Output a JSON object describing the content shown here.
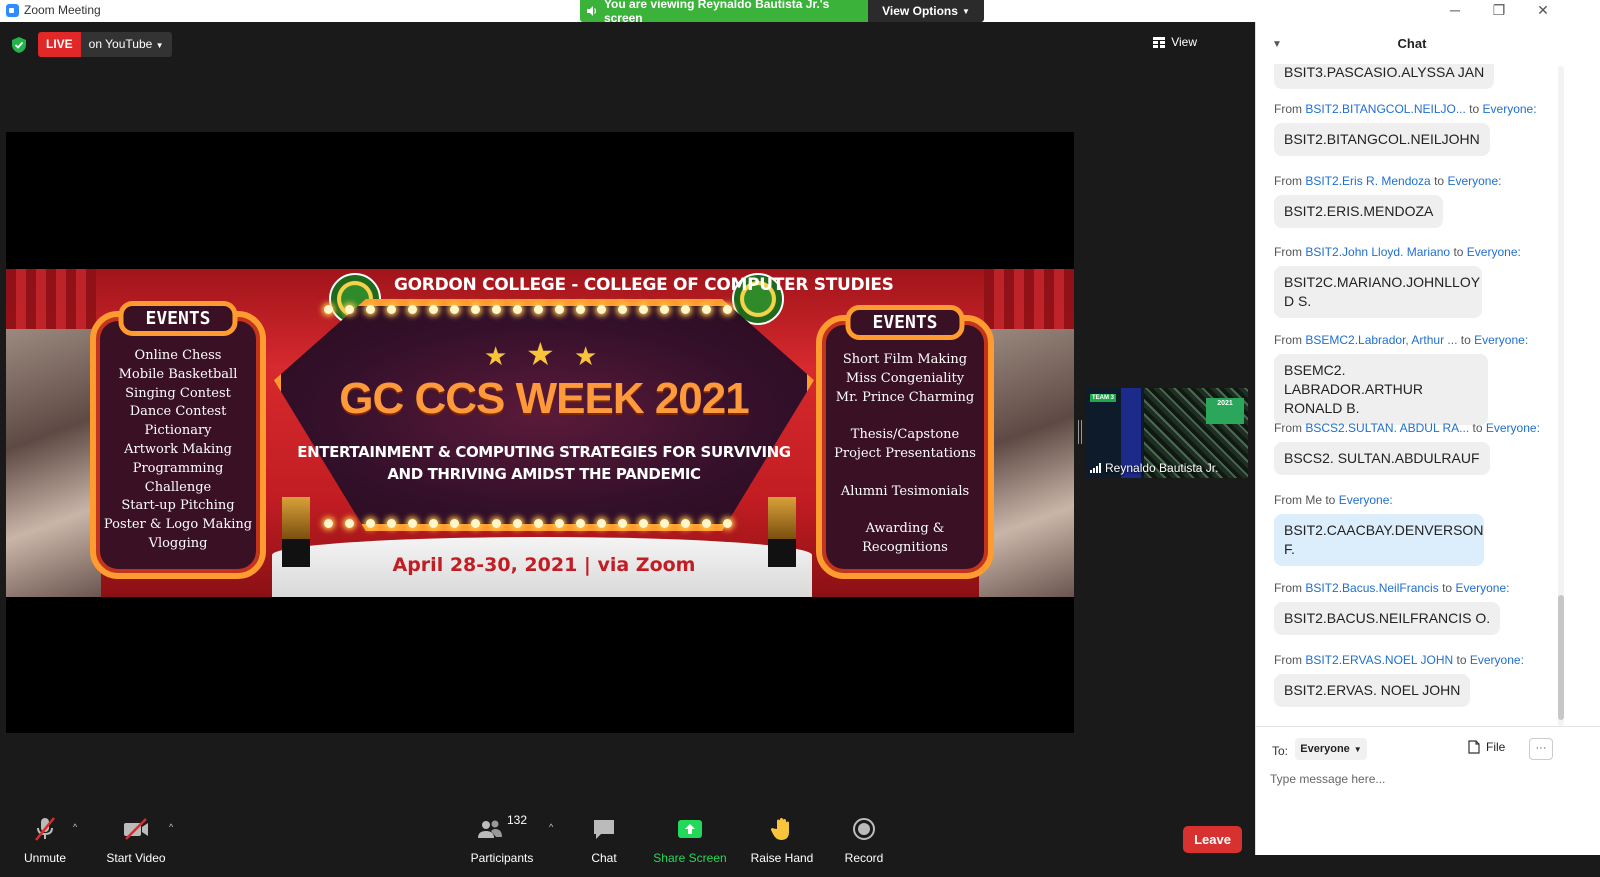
{
  "window": {
    "title": "Zoom Meeting",
    "minimize": "─",
    "restore": "❐",
    "close": "✕"
  },
  "banner": {
    "viewing_text": "You are viewing Reynaldo Bautista Jr.'s screen",
    "view_options": "View Options"
  },
  "live": {
    "label": "LIVE",
    "destination": "on YouTube"
  },
  "view_button": "View",
  "shared_content": {
    "college_title": "GORDON COLLEGE - COLLEGE OF COMPUTER STUDIES",
    "events_left_heading": "EVENTS",
    "events_left": [
      "Online Chess",
      "Mobile Basketball",
      "Singing Contest",
      "Dance Contest",
      "Pictionary",
      "Artwork Making",
      "Programming",
      "Challenge",
      "Start-up Pitching",
      "Poster & Logo Making",
      "Vlogging"
    ],
    "events_right_heading": "EVENTS",
    "events_right": [
      "Short Film Making",
      "Miss Congeniality",
      "Mr. Prince Charming",
      "",
      "Thesis/Capstone",
      "Project Presentations",
      "",
      "Alumni Tesimonials",
      "",
      "Awarding &",
      "Recognitions"
    ],
    "headline": "GC CCS WEEK 2021",
    "subtitle_line1": "ENTERTAINMENT & COMPUTING STRATEGIES FOR SURVIVING",
    "subtitle_line2": "AND THRIVING AMIDST THE PANDEMIC",
    "date_line": "April 28-30, 2021 | via Zoom"
  },
  "participant_thumb": {
    "name": "Reynaldo Bautista Jr.",
    "badge": "TEAM 3",
    "mini_text": "2021"
  },
  "toolbar": {
    "unmute": "Unmute",
    "start_video": "Start Video",
    "participants": "Participants",
    "participant_count": "132",
    "chat": "Chat",
    "share_screen": "Share Screen",
    "raise_hand": "Raise Hand",
    "record": "Record",
    "leave": "Leave"
  },
  "chat": {
    "title": "Chat",
    "partial_top": "BSIT3.PASCASIO.ALYSSA JAN",
    "messages": [
      {
        "from_prefix": "From",
        "from": "BSIT2.BITANGCOL.NEILJO...",
        "to_prefix": "to",
        "to": "Everyone:",
        "text": "BSIT2.BITANGCOL.NEILJOHN"
      },
      {
        "from_prefix": "From",
        "from": "BSIT2.Eris R. Mendoza",
        "to_prefix": "to",
        "to": "Everyone:",
        "text": "BSIT2.ERIS.MENDOZA"
      },
      {
        "from_prefix": "From",
        "from": "BSIT2.John Lloyd. Mariano",
        "to_prefix": "to",
        "to": "Everyone:",
        "text": "BSIT2C.MARIANO.JOHNLLOY D S."
      },
      {
        "from_prefix": "From",
        "from": "BSEMC2.Labrador, Arthur ...",
        "to_prefix": "to",
        "to": "Everyone:",
        "text": "BSEMC2. LABRADOR.ARTHUR RONALD B."
      },
      {
        "from_prefix": "From",
        "from": "BSCS2.SULTAN. ABDUL RA...",
        "to_prefix": "to",
        "to": "Everyone:",
        "text": "BSCS2. SULTAN.ABDULRAUF"
      },
      {
        "from_prefix": "From Me",
        "from": "",
        "to_prefix": "to",
        "to": "Everyone:",
        "text": "BSIT2.CAACBAY.DENVERSON F."
      },
      {
        "from_prefix": "From",
        "from": "BSIT2.Bacus.NeilFrancis",
        "to_prefix": "to",
        "to": "Everyone:",
        "text": "BSIT2.BACUS.NEILFRANCIS O."
      },
      {
        "from_prefix": "From",
        "from": "BSIT2.ERVAS.NOEL JOHN",
        "to_prefix": "to",
        "to": "Everyone:",
        "text": "BSIT2.ERVAS. NOEL JOHN"
      }
    ],
    "to_label": "To:",
    "to_value": "Everyone",
    "file_label": "File",
    "more_label": "···",
    "input_placeholder": "Type message here..."
  },
  "colors": {
    "live_red": "#e02828",
    "banner_green": "#3bb33b",
    "leave_red": "#d7322f",
    "share_green": "#23d959",
    "link_blue": "#1f6fd1"
  }
}
